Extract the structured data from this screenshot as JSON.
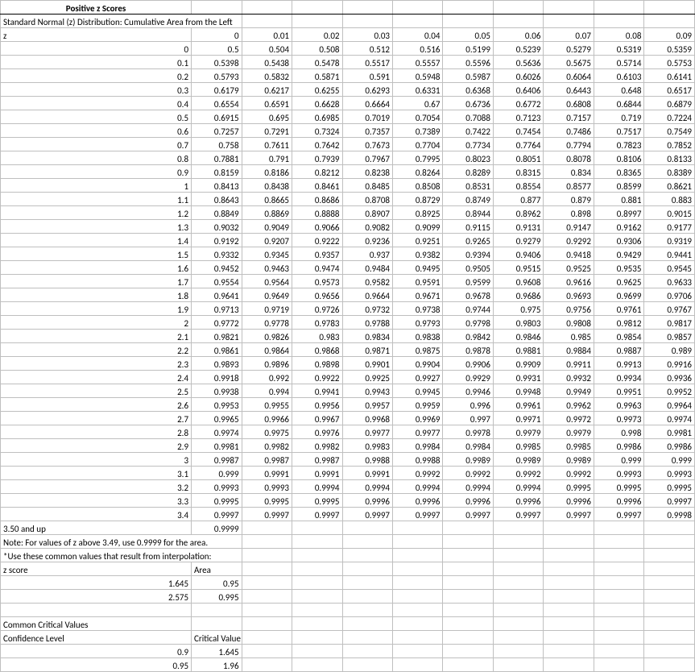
{
  "chart_data": {
    "type": "table",
    "title": "Positive z Scores",
    "subtitle": "Standard Normal (z) Distribution: Cumulative Area from the Left",
    "row_header": "z",
    "col_headers": [
      "0",
      "0.01",
      "0.02",
      "0.03",
      "0.04",
      "0.05",
      "0.06",
      "0.07",
      "0.08",
      "0.09"
    ],
    "rows": [
      {
        "z": "0",
        "v": [
          "0.5",
          "0.504",
          "0.508",
          "0.512",
          "0.516",
          "0.5199",
          "0.5239",
          "0.5279",
          "0.5319",
          "0.5359"
        ]
      },
      {
        "z": "0.1",
        "v": [
          "0.5398",
          "0.5438",
          "0.5478",
          "0.5517",
          "0.5557",
          "0.5596",
          "0.5636",
          "0.5675",
          "0.5714",
          "0.5753"
        ]
      },
      {
        "z": "0.2",
        "v": [
          "0.5793",
          "0.5832",
          "0.5871",
          "0.591",
          "0.5948",
          "0.5987",
          "0.6026",
          "0.6064",
          "0.6103",
          "0.6141"
        ]
      },
      {
        "z": "0.3",
        "v": [
          "0.6179",
          "0.6217",
          "0.6255",
          "0.6293",
          "0.6331",
          "0.6368",
          "0.6406",
          "0.6443",
          "0.648",
          "0.6517"
        ]
      },
      {
        "z": "0.4",
        "v": [
          "0.6554",
          "0.6591",
          "0.6628",
          "0.6664",
          "0.67",
          "0.6736",
          "0.6772",
          "0.6808",
          "0.6844",
          "0.6879"
        ]
      },
      {
        "z": "0.5",
        "v": [
          "0.6915",
          "0.695",
          "0.6985",
          "0.7019",
          "0.7054",
          "0.7088",
          "0.7123",
          "0.7157",
          "0.719",
          "0.7224"
        ]
      },
      {
        "z": "0.6",
        "v": [
          "0.7257",
          "0.7291",
          "0.7324",
          "0.7357",
          "0.7389",
          "0.7422",
          "0.7454",
          "0.7486",
          "0.7517",
          "0.7549"
        ]
      },
      {
        "z": "0.7",
        "v": [
          "0.758",
          "0.7611",
          "0.7642",
          "0.7673",
          "0.7704",
          "0.7734",
          "0.7764",
          "0.7794",
          "0.7823",
          "0.7852"
        ]
      },
      {
        "z": "0.8",
        "v": [
          "0.7881",
          "0.791",
          "0.7939",
          "0.7967",
          "0.7995",
          "0.8023",
          "0.8051",
          "0.8078",
          "0.8106",
          "0.8133"
        ]
      },
      {
        "z": "0.9",
        "v": [
          "0.8159",
          "0.8186",
          "0.8212",
          "0.8238",
          "0.8264",
          "0.8289",
          "0.8315",
          "0.834",
          "0.8365",
          "0.8389"
        ]
      },
      {
        "z": "1",
        "v": [
          "0.8413",
          "0.8438",
          "0.8461",
          "0.8485",
          "0.8508",
          "0.8531",
          "0.8554",
          "0.8577",
          "0.8599",
          "0.8621"
        ]
      },
      {
        "z": "1.1",
        "v": [
          "0.8643",
          "0.8665",
          "0.8686",
          "0.8708",
          "0.8729",
          "0.8749",
          "0.877",
          "0.879",
          "0.881",
          "0.883"
        ]
      },
      {
        "z": "1.2",
        "v": [
          "0.8849",
          "0.8869",
          "0.8888",
          "0.8907",
          "0.8925",
          "0.8944",
          "0.8962",
          "0.898",
          "0.8997",
          "0.9015"
        ]
      },
      {
        "z": "1.3",
        "v": [
          "0.9032",
          "0.9049",
          "0.9066",
          "0.9082",
          "0.9099",
          "0.9115",
          "0.9131",
          "0.9147",
          "0.9162",
          "0.9177"
        ]
      },
      {
        "z": "1.4",
        "v": [
          "0.9192",
          "0.9207",
          "0.9222",
          "0.9236",
          "0.9251",
          "0.9265",
          "0.9279",
          "0.9292",
          "0.9306",
          "0.9319"
        ]
      },
      {
        "z": "1.5",
        "v": [
          "0.9332",
          "0.9345",
          "0.9357",
          "0.937",
          "0.9382",
          "0.9394",
          "0.9406",
          "0.9418",
          "0.9429",
          "0.9441"
        ]
      },
      {
        "z": "1.6",
        "v": [
          "0.9452",
          "0.9463",
          "0.9474",
          "0.9484",
          "0.9495",
          "0.9505",
          "0.9515",
          "0.9525",
          "0.9535",
          "0.9545"
        ]
      },
      {
        "z": "1.7",
        "v": [
          "0.9554",
          "0.9564",
          "0.9573",
          "0.9582",
          "0.9591",
          "0.9599",
          "0.9608",
          "0.9616",
          "0.9625",
          "0.9633"
        ]
      },
      {
        "z": "1.8",
        "v": [
          "0.9641",
          "0.9649",
          "0.9656",
          "0.9664",
          "0.9671",
          "0.9678",
          "0.9686",
          "0.9693",
          "0.9699",
          "0.9706"
        ]
      },
      {
        "z": "1.9",
        "v": [
          "0.9713",
          "0.9719",
          "0.9726",
          "0.9732",
          "0.9738",
          "0.9744",
          "0.975",
          "0.9756",
          "0.9761",
          "0.9767"
        ]
      },
      {
        "z": "2",
        "v": [
          "0.9772",
          "0.9778",
          "0.9783",
          "0.9788",
          "0.9793",
          "0.9798",
          "0.9803",
          "0.9808",
          "0.9812",
          "0.9817"
        ]
      },
      {
        "z": "2.1",
        "v": [
          "0.9821",
          "0.9826",
          "0.983",
          "0.9834",
          "0.9838",
          "0.9842",
          "0.9846",
          "0.985",
          "0.9854",
          "0.9857"
        ]
      },
      {
        "z": "2.2",
        "v": [
          "0.9861",
          "0.9864",
          "0.9868",
          "0.9871",
          "0.9875",
          "0.9878",
          "0.9881",
          "0.9884",
          "0.9887",
          "0.989"
        ]
      },
      {
        "z": "2.3",
        "v": [
          "0.9893",
          "0.9896",
          "0.9898",
          "0.9901",
          "0.9904",
          "0.9906",
          "0.9909",
          "0.9911",
          "0.9913",
          "0.9916"
        ]
      },
      {
        "z": "2.4",
        "v": [
          "0.9918",
          "0.992",
          "0.9922",
          "0.9925",
          "0.9927",
          "0.9929",
          "0.9931",
          "0.9932",
          "0.9934",
          "0.9936"
        ]
      },
      {
        "z": "2.5",
        "v": [
          "0.9938",
          "0.994",
          "0.9941",
          "0.9943",
          "0.9945",
          "0.9946",
          "0.9948",
          "0.9949",
          "0.9951",
          "0.9952"
        ]
      },
      {
        "z": "2.6",
        "v": [
          "0.9953",
          "0.9955",
          "0.9956",
          "0.9957",
          "0.9959",
          "0.996",
          "0.9961",
          "0.9962",
          "0.9963",
          "0.9964"
        ]
      },
      {
        "z": "2.7",
        "v": [
          "0.9965",
          "0.9966",
          "0.9967",
          "0.9968",
          "0.9969",
          "0.997",
          "0.9971",
          "0.9972",
          "0.9973",
          "0.9974"
        ]
      },
      {
        "z": "2.8",
        "v": [
          "0.9974",
          "0.9975",
          "0.9976",
          "0.9977",
          "0.9977",
          "0.9978",
          "0.9979",
          "0.9979",
          "0.998",
          "0.9981"
        ]
      },
      {
        "z": "2.9",
        "v": [
          "0.9981",
          "0.9982",
          "0.9982",
          "0.9983",
          "0.9984",
          "0.9984",
          "0.9985",
          "0.9985",
          "0.9986",
          "0.9986"
        ]
      },
      {
        "z": "3",
        "v": [
          "0.9987",
          "0.9987",
          "0.9987",
          "0.9988",
          "0.9988",
          "0.9989",
          "0.9989",
          "0.9989",
          "0.999",
          "0.999"
        ]
      },
      {
        "z": "3.1",
        "v": [
          "0.999",
          "0.9991",
          "0.9991",
          "0.9991",
          "0.9992",
          "0.9992",
          "0.9992",
          "0.9992",
          "0.9993",
          "0.9993"
        ]
      },
      {
        "z": "3.2",
        "v": [
          "0.9993",
          "0.9993",
          "0.9994",
          "0.9994",
          "0.9994",
          "0.9994",
          "0.9994",
          "0.9995",
          "0.9995",
          "0.9995"
        ]
      },
      {
        "z": "3.3",
        "v": [
          "0.9995",
          "0.9995",
          "0.9995",
          "0.9996",
          "0.9996",
          "0.9996",
          "0.9996",
          "0.9996",
          "0.9996",
          "0.9997"
        ]
      },
      {
        "z": "3.4",
        "v": [
          "0.9997",
          "0.9997",
          "0.9997",
          "0.9997",
          "0.9997",
          "0.9997",
          "0.9997",
          "0.9997",
          "0.9997",
          "0.9998"
        ]
      }
    ],
    "tail": {
      "label": "3.50 and up",
      "value": "0.9999"
    },
    "note": "Note: For values of z above 3.49, use 0.9999 for the area.",
    "interp_header": "*Use these common values that result from interpolation:",
    "interp_col1": "z score",
    "interp_col2": "Area",
    "interp_rows": [
      {
        "z": "1.645",
        "a": "0.95"
      },
      {
        "z": "2.575",
        "a": "0.995"
      }
    ],
    "crit_header": "Common Critical Values",
    "crit_col1": "Confidence Level",
    "crit_col2": "Critical Value",
    "crit_rows": [
      {
        "c": "0.9",
        "v": "1.645"
      },
      {
        "c": "0.95",
        "v": "1.96"
      }
    ]
  }
}
